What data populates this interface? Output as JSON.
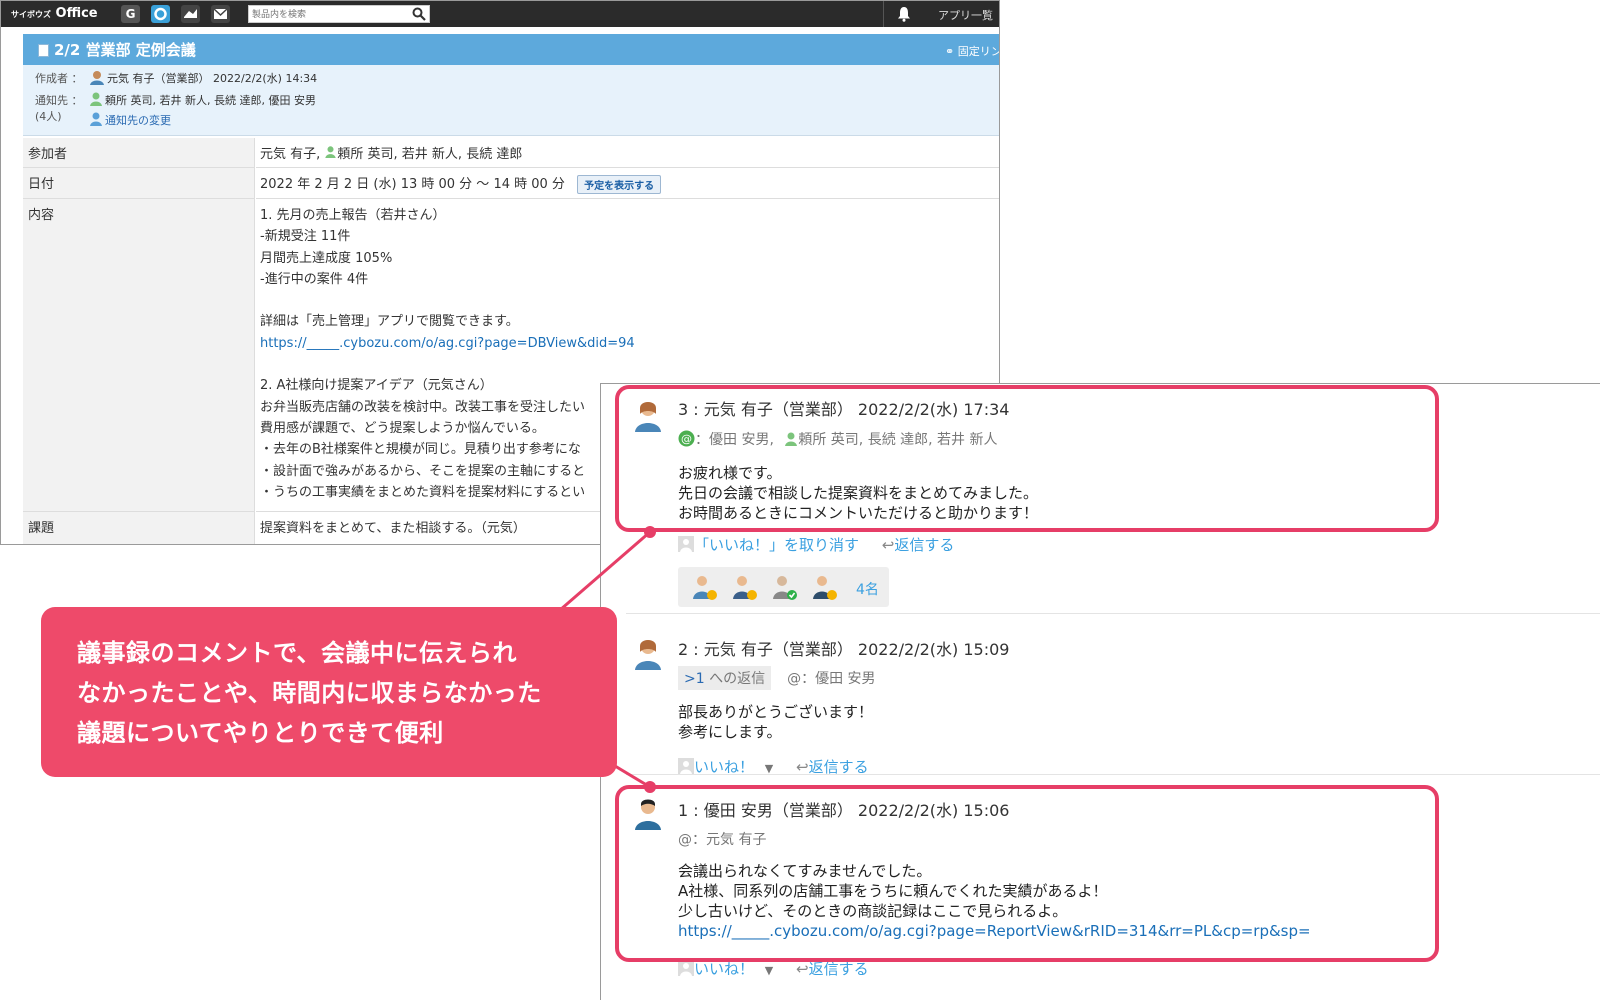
{
  "topbar": {
    "logo_text": "Office",
    "logo_prefix": "サイボウズ",
    "search_placeholder": "製品内を検索",
    "app_list_label": "アプリ一覧",
    "icons": [
      "garoon-icon",
      "office-icon",
      "mailwise-icon",
      "mail-icon",
      "search-icon",
      "bell-icon"
    ]
  },
  "report": {
    "title": "2/2 営業部 定例会議",
    "fixed_link_label": "固定リンク",
    "author_label": "作成者 ：",
    "author_value": "元気 有子（営業部） 2022/2/2(水) 14:34",
    "notify_label": "通知先 ：",
    "notify_count": "(4人)",
    "notify_value": "頼所 英司, 若井 新人, 長続 達郎, 優田 安男",
    "notify_change_link": "通知先の変更",
    "rows": {
      "participants_label": "参加者",
      "participants_value_a": "元気 有子,",
      "participants_value_b": "頼所 英司, 若井 新人, 長続 達郎",
      "date_label": "日付",
      "date_value": "2022 年 2 月 2 日 (水) 13 時 00 分 〜 14 時 00 分",
      "schedule_button": "予定を表示する",
      "content_label": "内容",
      "content_lines": [
        "1. 先月の売上報告（若井さん）",
        "-新規受注 11件",
        " 月間売上達成度 105%",
        "-進行中の案件 4件",
        "",
        "詳細は「売上管理」アプリで閲覧できます。",
        "https://_____.cybozu.com/o/ag.cgi?page=DBView&did=94",
        "",
        "2. A社様向け提案アイデア（元気さん）",
        "お弁当販売店舗の改装を検討中。改装工事を受注したい",
        "費用感が課題で、どう提案しようか悩んでいる。",
        "・去年のB社様案件と規模が同じ。見積り出す参考にな",
        "・設計面で強みがあるから、そこを提案の主軸にすると",
        "・うちの工事実績をまとめた資料を提案材料にするとい"
      ],
      "issue_label": "課題",
      "issue_value": "提案資料をまとめて、また相談する。（元気）"
    }
  },
  "comments": [
    {
      "header": "3 : 元気 有子（営業部） 2022/2/2(水) 17:34",
      "mention": "：優田 安男,",
      "mention_b": "頼所 英司, 長続 達郎, 若井 新人",
      "body": [
        "お疲れ様です。",
        "先日の会議で相談した提案資料をまとめてみました。",
        "お時間あるときにコメントいただけると助かります！"
      ],
      "like_action": "「いいね！」を取り消す",
      "reply_action": "返信する",
      "likers_count": "4名"
    },
    {
      "header": "2 : 元気 有子（営業部） 2022/2/2(水) 15:09",
      "reply_to_num": ">1",
      "reply_to_label": "への返信",
      "mention": "@：優田 安男",
      "body": [
        "部長ありがとうございます！",
        "参考にします。"
      ],
      "like_action": "いいね！",
      "reply_action": "返信する"
    },
    {
      "header": "1 : 優田 安男（営業部） 2022/2/2(水) 15:06",
      "mention": "@：元気 有子",
      "body": [
        "会議出られなくてすみませんでした。",
        "A社様、同系列の店舗工事をうちに頼んでくれた実績があるよ！",
        "少し古いけど、そのときの商談記録はここで見られるよ。"
      ],
      "link": "https://_____.cybozu.com/o/ag.cgi?page=ReportView&rRID=314&rr=PL&cp=rp&sp=",
      "like_action": "いいね！",
      "reply_action": "返信する"
    }
  ],
  "callout": {
    "lines": [
      "議事録のコメントで、会議中に伝えられ",
      "なかったことや、時間内に収まらなかった",
      "議題についてやりとりできて便利"
    ]
  },
  "colors": {
    "accent_pink": "#e63e67",
    "title_blue": "#5da9dc",
    "link_blue": "#1a6fb8",
    "action_blue": "#3ba0e0"
  }
}
